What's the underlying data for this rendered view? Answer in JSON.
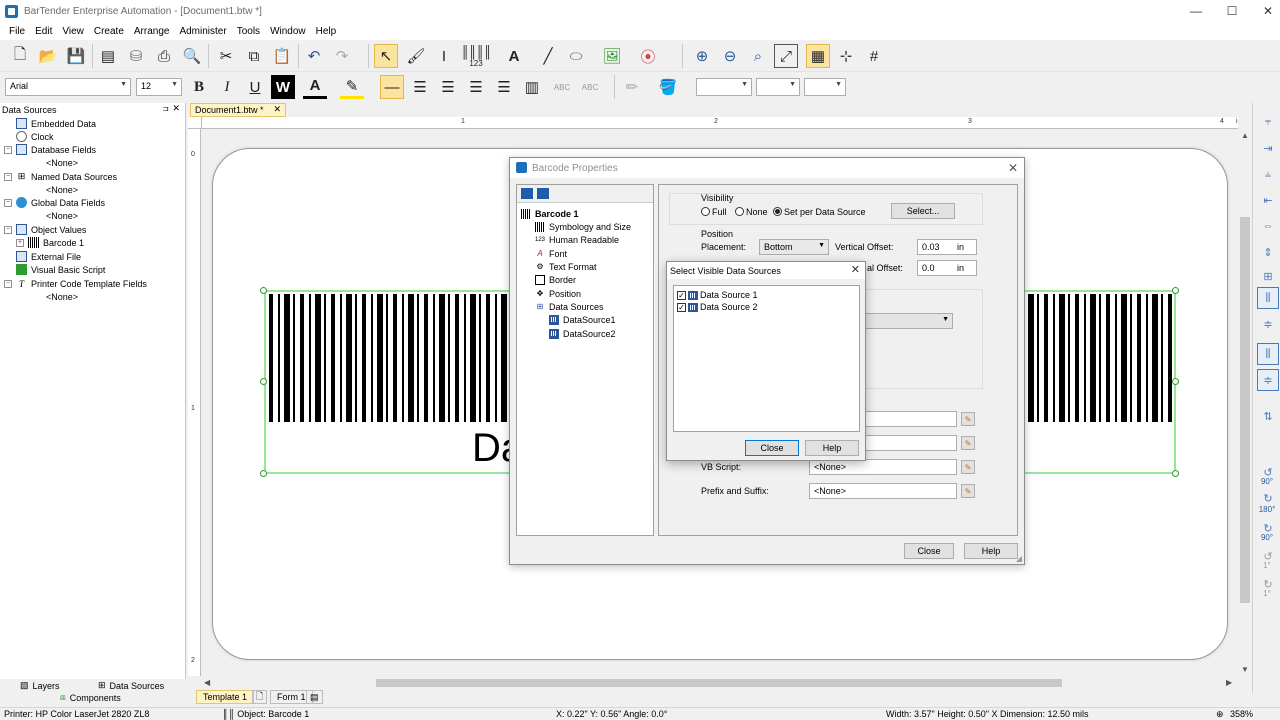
{
  "window": {
    "title": "BarTender Enterprise Automation - [Document1.btw *]",
    "minimize": "—",
    "maximize": "☐",
    "close": "✕"
  },
  "menu": [
    "File",
    "Edit",
    "View",
    "Create",
    "Arrange",
    "Administer",
    "Tools",
    "Window",
    "Help"
  ],
  "toolbar": {
    "font_name": "Arial",
    "font_size": "12",
    "bold": "B",
    "italic": "I",
    "underline": "U",
    "wordwrap": "W",
    "font_color": "A",
    "barcode_label": "123"
  },
  "data_sources_panel": {
    "title": "Data Sources",
    "pin": "⊐",
    "close": "✕",
    "items": [
      {
        "label": "Embedded Data",
        "level": 1
      },
      {
        "label": "Clock",
        "level": 1
      },
      {
        "label": "Database Fields",
        "level": 0
      },
      {
        "label": "<None>",
        "level": 2
      },
      {
        "label": "Named Data Sources",
        "level": 0
      },
      {
        "label": "<None>",
        "level": 2
      },
      {
        "label": "Global Data Fields",
        "level": 0
      },
      {
        "label": "<None>",
        "level": 2
      },
      {
        "label": "Object Values",
        "level": 0
      },
      {
        "label": "Barcode 1",
        "level": 1
      },
      {
        "label": "External File",
        "level": 1
      },
      {
        "label": "Visual Basic Script",
        "level": 1
      },
      {
        "label": "Printer Code Template Fields",
        "level": 0
      },
      {
        "label": "<None>",
        "level": 2
      }
    ],
    "bottom_tabs": [
      "Layers",
      "Data Sources",
      "Components"
    ]
  },
  "document_tab": {
    "label": "Document1.btw *",
    "close": "✕"
  },
  "ruler": {
    "h": [
      "1",
      "2",
      "3",
      "4",
      "in"
    ],
    "v": [
      "0",
      "1",
      "2"
    ]
  },
  "barcode": {
    "text": "Da"
  },
  "template_tabs": [
    "Template 1",
    "Form 1"
  ],
  "right_toolbar": {
    "labels": [
      "90°",
      "180°",
      "90°",
      "1°",
      "1°"
    ]
  },
  "status": {
    "printer": "Printer: HP Color LaserJet 2820 ZL8",
    "object": "Object: Barcode 1",
    "position": "X: 0.22\"  Y: 0.56\"  Angle: 0.0°",
    "dimensions": "Width: 3.57\"  Height: 0.50\"  X Dimension: 12.50 mils",
    "zoom": "358%"
  },
  "barcode_properties": {
    "title": "Barcode Properties",
    "tree": {
      "root": "Barcode 1",
      "items": [
        "Symbology and Size",
        "Human Readable",
        "Font",
        "Text Format",
        "Border",
        "Position",
        "Data Sources"
      ],
      "data_sources": [
        "DataSource1",
        "DataSource2"
      ]
    },
    "visibility": {
      "label": "Visibility",
      "options": [
        "Full",
        "None",
        "Set per Data Source"
      ],
      "selected": "Set per Data Source",
      "select_button": "Select..."
    },
    "position": {
      "label": "Position",
      "placement_label": "Placement:",
      "placement_value": "Bottom",
      "v_offset_label": "Vertical Offset:",
      "v_offset_value": "0.03",
      "v_offset_unit": "in",
      "h_offset_label": "al Offset:",
      "h_offset_value": "0.0",
      "h_offset_unit": "in"
    },
    "vb_script_label": "VB Script:",
    "vb_script_value": "<None>",
    "prefix_suffix_label": "Prefix and Suffix:",
    "prefix_suffix_value": "<None>",
    "close_button": "Close",
    "help_button": "Help"
  },
  "select_visible": {
    "title": "Select Visible Data Sources",
    "close_x": "✕",
    "items": [
      {
        "label": "Data Source 1",
        "checked": true
      },
      {
        "label": "Data Source 2",
        "checked": true
      }
    ],
    "close_button": "Close",
    "help_button": "Help"
  },
  "colors": {
    "accent": "#1d6fb8",
    "selection_green": "#99e699",
    "doc_tab": "#fdf3c4"
  }
}
